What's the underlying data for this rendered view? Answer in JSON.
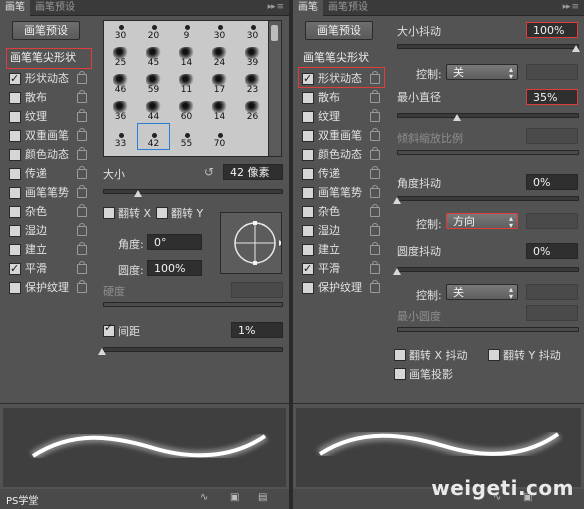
{
  "left": {
    "tabs": [
      "画笔",
      "画笔预设"
    ],
    "preset_button": "画笔预设",
    "sidebar": [
      {
        "label": "画笔笔尖形状",
        "head": true
      },
      {
        "label": "形状动态",
        "checked": true
      },
      {
        "label": "散布",
        "checked": false
      },
      {
        "label": "纹理",
        "checked": false
      },
      {
        "label": "双重画笔",
        "checked": false
      },
      {
        "label": "颜色动态",
        "checked": false
      },
      {
        "label": "传递",
        "checked": false
      },
      {
        "label": "画笔笔势",
        "checked": false
      },
      {
        "label": "杂色",
        "checked": false
      },
      {
        "label": "湿边",
        "checked": false
      },
      {
        "label": "建立",
        "checked": false
      },
      {
        "label": "平滑",
        "checked": true
      },
      {
        "label": "保护纹理",
        "checked": false
      }
    ],
    "brush_sizes": [
      30,
      20,
      9,
      30,
      30,
      25,
      45,
      14,
      24,
      39,
      46,
      59,
      11,
      17,
      23,
      36,
      44,
      60,
      14,
      26,
      33,
      42,
      55,
      70
    ],
    "selected_size": "42",
    "size_label": "大小",
    "size_value": "42 像素",
    "flip_x": "翻转 X",
    "flip_y": "翻转 Y",
    "angle_label": "角度:",
    "angle_value": "0°",
    "roundness_label": "圆度:",
    "roundness_value": "100%",
    "hardness_label": "硬度",
    "spacing_label": "间距",
    "spacing_value": "1%",
    "spacing_checked": true
  },
  "right": {
    "tabs": [
      "画笔",
      "画笔预设"
    ],
    "preset_button": "画笔预设",
    "sidebar": [
      {
        "label": "画笔笔尖形状",
        "head": true
      },
      {
        "label": "形状动态",
        "checked": true
      },
      {
        "label": "散布",
        "checked": false
      },
      {
        "label": "纹理",
        "checked": false
      },
      {
        "label": "双重画笔",
        "checked": false
      },
      {
        "label": "颜色动态",
        "checked": false
      },
      {
        "label": "传递",
        "checked": false
      },
      {
        "label": "画笔笔势",
        "checked": false
      },
      {
        "label": "杂色",
        "checked": false
      },
      {
        "label": "湿边",
        "checked": false
      },
      {
        "label": "建立",
        "checked": false
      },
      {
        "label": "平滑",
        "checked": true
      },
      {
        "label": "保护纹理",
        "checked": false
      }
    ],
    "size_jitter_label": "大小抖动",
    "size_jitter_value": "100%",
    "control_label": "控制:",
    "control1_value": "关",
    "min_diameter_label": "最小直径",
    "min_diameter_value": "35%",
    "tilt_scale_label": "倾斜缩放比例",
    "angle_jitter_label": "角度抖动",
    "angle_jitter_value": "0%",
    "control2_value": "方向",
    "roundness_jitter_label": "圆度抖动",
    "roundness_jitter_value": "0%",
    "control3_value": "关",
    "min_roundness_label": "最小圆度",
    "flip_x_jitter": "翻转 X 抖动",
    "flip_y_jitter": "翻转 Y 抖动",
    "brush_projection": "画笔投影"
  },
  "watermark": "weigeti.com",
  "brand_left": "PS学堂"
}
